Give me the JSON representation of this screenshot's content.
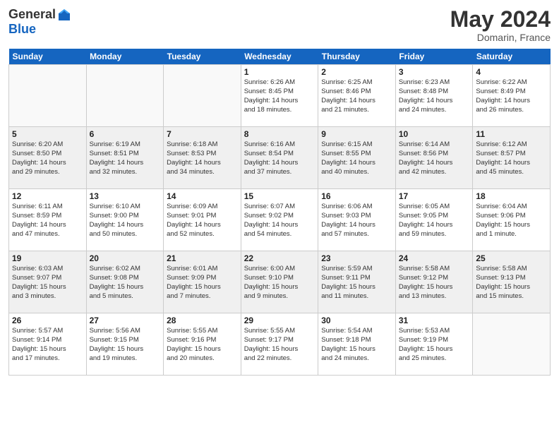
{
  "header": {
    "logo_general": "General",
    "logo_blue": "Blue",
    "month_title": "May 2024",
    "location": "Domarin, France"
  },
  "days_of_week": [
    "Sunday",
    "Monday",
    "Tuesday",
    "Wednesday",
    "Thursday",
    "Friday",
    "Saturday"
  ],
  "weeks": [
    [
      {
        "day": "",
        "lines": []
      },
      {
        "day": "",
        "lines": []
      },
      {
        "day": "",
        "lines": []
      },
      {
        "day": "1",
        "lines": [
          "Sunrise: 6:26 AM",
          "Sunset: 8:45 PM",
          "Daylight: 14 hours",
          "and 18 minutes."
        ]
      },
      {
        "day": "2",
        "lines": [
          "Sunrise: 6:25 AM",
          "Sunset: 8:46 PM",
          "Daylight: 14 hours",
          "and 21 minutes."
        ]
      },
      {
        "day": "3",
        "lines": [
          "Sunrise: 6:23 AM",
          "Sunset: 8:48 PM",
          "Daylight: 14 hours",
          "and 24 minutes."
        ]
      },
      {
        "day": "4",
        "lines": [
          "Sunrise: 6:22 AM",
          "Sunset: 8:49 PM",
          "Daylight: 14 hours",
          "and 26 minutes."
        ]
      }
    ],
    [
      {
        "day": "5",
        "lines": [
          "Sunrise: 6:20 AM",
          "Sunset: 8:50 PM",
          "Daylight: 14 hours",
          "and 29 minutes."
        ]
      },
      {
        "day": "6",
        "lines": [
          "Sunrise: 6:19 AM",
          "Sunset: 8:51 PM",
          "Daylight: 14 hours",
          "and 32 minutes."
        ]
      },
      {
        "day": "7",
        "lines": [
          "Sunrise: 6:18 AM",
          "Sunset: 8:53 PM",
          "Daylight: 14 hours",
          "and 34 minutes."
        ]
      },
      {
        "day": "8",
        "lines": [
          "Sunrise: 6:16 AM",
          "Sunset: 8:54 PM",
          "Daylight: 14 hours",
          "and 37 minutes."
        ]
      },
      {
        "day": "9",
        "lines": [
          "Sunrise: 6:15 AM",
          "Sunset: 8:55 PM",
          "Daylight: 14 hours",
          "and 40 minutes."
        ]
      },
      {
        "day": "10",
        "lines": [
          "Sunrise: 6:14 AM",
          "Sunset: 8:56 PM",
          "Daylight: 14 hours",
          "and 42 minutes."
        ]
      },
      {
        "day": "11",
        "lines": [
          "Sunrise: 6:12 AM",
          "Sunset: 8:57 PM",
          "Daylight: 14 hours",
          "and 45 minutes."
        ]
      }
    ],
    [
      {
        "day": "12",
        "lines": [
          "Sunrise: 6:11 AM",
          "Sunset: 8:59 PM",
          "Daylight: 14 hours",
          "and 47 minutes."
        ]
      },
      {
        "day": "13",
        "lines": [
          "Sunrise: 6:10 AM",
          "Sunset: 9:00 PM",
          "Daylight: 14 hours",
          "and 50 minutes."
        ]
      },
      {
        "day": "14",
        "lines": [
          "Sunrise: 6:09 AM",
          "Sunset: 9:01 PM",
          "Daylight: 14 hours",
          "and 52 minutes."
        ]
      },
      {
        "day": "15",
        "lines": [
          "Sunrise: 6:07 AM",
          "Sunset: 9:02 PM",
          "Daylight: 14 hours",
          "and 54 minutes."
        ]
      },
      {
        "day": "16",
        "lines": [
          "Sunrise: 6:06 AM",
          "Sunset: 9:03 PM",
          "Daylight: 14 hours",
          "and 57 minutes."
        ]
      },
      {
        "day": "17",
        "lines": [
          "Sunrise: 6:05 AM",
          "Sunset: 9:05 PM",
          "Daylight: 14 hours",
          "and 59 minutes."
        ]
      },
      {
        "day": "18",
        "lines": [
          "Sunrise: 6:04 AM",
          "Sunset: 9:06 PM",
          "Daylight: 15 hours",
          "and 1 minute."
        ]
      }
    ],
    [
      {
        "day": "19",
        "lines": [
          "Sunrise: 6:03 AM",
          "Sunset: 9:07 PM",
          "Daylight: 15 hours",
          "and 3 minutes."
        ]
      },
      {
        "day": "20",
        "lines": [
          "Sunrise: 6:02 AM",
          "Sunset: 9:08 PM",
          "Daylight: 15 hours",
          "and 5 minutes."
        ]
      },
      {
        "day": "21",
        "lines": [
          "Sunrise: 6:01 AM",
          "Sunset: 9:09 PM",
          "Daylight: 15 hours",
          "and 7 minutes."
        ]
      },
      {
        "day": "22",
        "lines": [
          "Sunrise: 6:00 AM",
          "Sunset: 9:10 PM",
          "Daylight: 15 hours",
          "and 9 minutes."
        ]
      },
      {
        "day": "23",
        "lines": [
          "Sunrise: 5:59 AM",
          "Sunset: 9:11 PM",
          "Daylight: 15 hours",
          "and 11 minutes."
        ]
      },
      {
        "day": "24",
        "lines": [
          "Sunrise: 5:58 AM",
          "Sunset: 9:12 PM",
          "Daylight: 15 hours",
          "and 13 minutes."
        ]
      },
      {
        "day": "25",
        "lines": [
          "Sunrise: 5:58 AM",
          "Sunset: 9:13 PM",
          "Daylight: 15 hours",
          "and 15 minutes."
        ]
      }
    ],
    [
      {
        "day": "26",
        "lines": [
          "Sunrise: 5:57 AM",
          "Sunset: 9:14 PM",
          "Daylight: 15 hours",
          "and 17 minutes."
        ]
      },
      {
        "day": "27",
        "lines": [
          "Sunrise: 5:56 AM",
          "Sunset: 9:15 PM",
          "Daylight: 15 hours",
          "and 19 minutes."
        ]
      },
      {
        "day": "28",
        "lines": [
          "Sunrise: 5:55 AM",
          "Sunset: 9:16 PM",
          "Daylight: 15 hours",
          "and 20 minutes."
        ]
      },
      {
        "day": "29",
        "lines": [
          "Sunrise: 5:55 AM",
          "Sunset: 9:17 PM",
          "Daylight: 15 hours",
          "and 22 minutes."
        ]
      },
      {
        "day": "30",
        "lines": [
          "Sunrise: 5:54 AM",
          "Sunset: 9:18 PM",
          "Daylight: 15 hours",
          "and 24 minutes."
        ]
      },
      {
        "day": "31",
        "lines": [
          "Sunrise: 5:53 AM",
          "Sunset: 9:19 PM",
          "Daylight: 15 hours",
          "and 25 minutes."
        ]
      },
      {
        "day": "",
        "lines": []
      }
    ]
  ]
}
